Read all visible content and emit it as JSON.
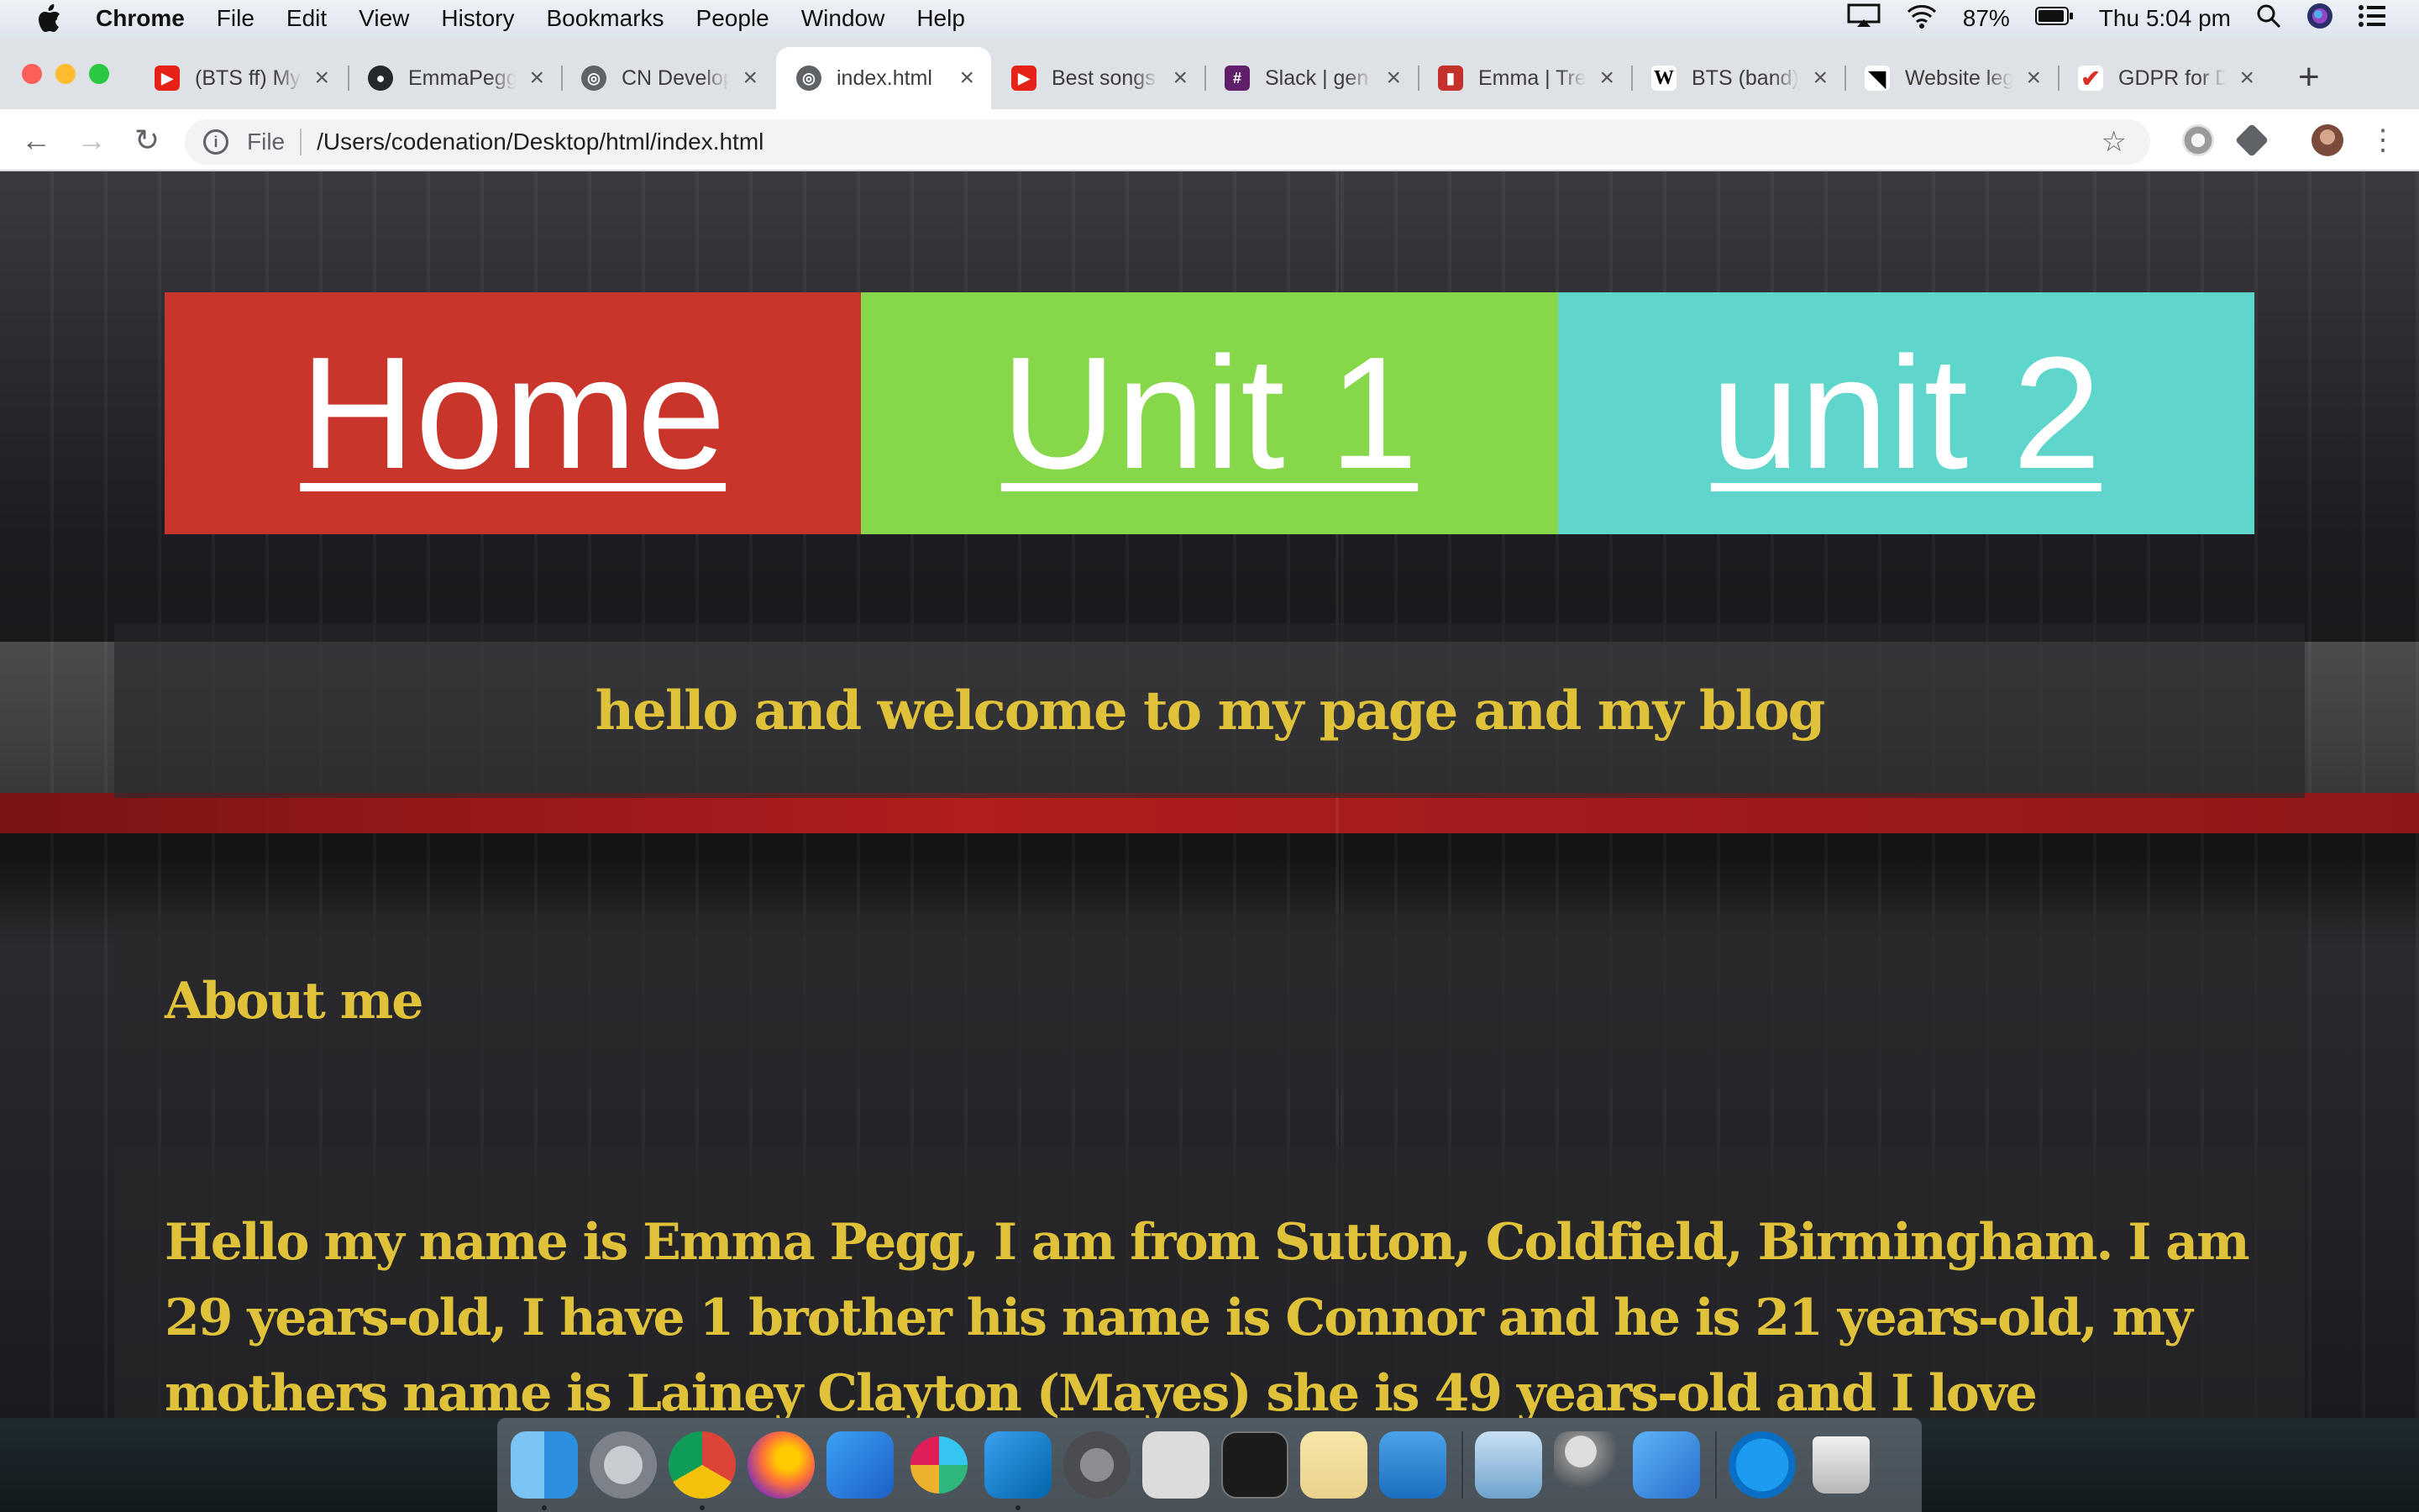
{
  "menubar": {
    "app": "Chrome",
    "items": [
      "File",
      "Edit",
      "View",
      "History",
      "Bookmarks",
      "People",
      "Window",
      "Help"
    ],
    "battery": "87%",
    "clock": "Thu 5:04 pm"
  },
  "tabs": [
    {
      "title": "(BTS ff) My",
      "icon": "youtube-icon",
      "color": "#e62117"
    },
    {
      "title": "EmmaPegg",
      "icon": "github-icon",
      "color": "#24292e"
    },
    {
      "title": "CN Develop",
      "icon": "globe-icon",
      "color": "#5f6368"
    },
    {
      "title": "index.html",
      "icon": "globe-icon",
      "color": "#5f6368",
      "active": true
    },
    {
      "title": "Best songs",
      "icon": "youtube-icon",
      "color": "#e62117"
    },
    {
      "title": "Slack | gen",
      "icon": "slack-icon",
      "color": "#611f69"
    },
    {
      "title": "Emma | Tre",
      "icon": "trello-icon",
      "color": "#c4302b"
    },
    {
      "title": "BTS (band)",
      "icon": "wikipedia-icon",
      "color": "#ffffff"
    },
    {
      "title": "Website leg",
      "icon": "arrow-logo-icon",
      "color": "#000000"
    },
    {
      "title": "GDPR for D",
      "icon": "check-logo-icon",
      "color": "#d93025"
    }
  ],
  "address": {
    "scheme": "File",
    "path": "/Users/codenation/Desktop/html/index.html"
  },
  "page": {
    "nav": [
      {
        "label": "Home",
        "color": "#c9342b"
      },
      {
        "label": "Unit 1",
        "color": "#86d84a"
      },
      {
        "label": "unit 2",
        "color": "#5ed6cb"
      }
    ],
    "welcome": "hello and welcome to my page and my blog",
    "about_heading": "About me",
    "bio": "Hello my name is Emma Pegg, I am from Sutton, Coldfield, Birmingham. I am 29 years-old, I have 1 brother his name is Connor and he is 21 years-old, my mothers name is Lainey Clayton (Mayes) she is 49 years-old and I love spending time with",
    "text_color": "#e0c23a"
  },
  "dock": [
    "finder-icon",
    "launchpad-icon",
    "chrome-icon",
    "firefox-icon",
    "xcode-icon",
    "slack-icon",
    "vscode-icon",
    "system-preferences-icon",
    "screenshot-icon",
    "terminal-icon",
    "textedit-icon",
    "keynote-icon",
    "preview-icon",
    "keychain-icon",
    "simulator-icon",
    "app-store-icon",
    "trash-icon"
  ]
}
